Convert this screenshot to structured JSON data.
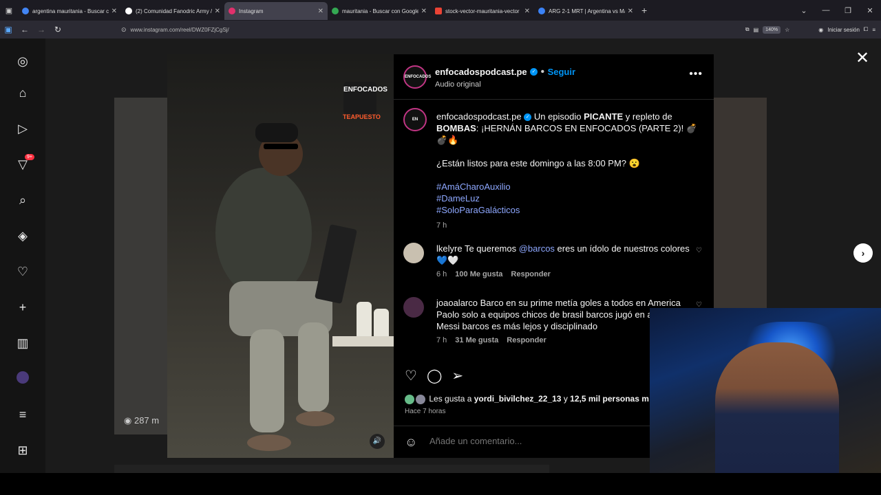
{
  "browser": {
    "tabs": [
      {
        "title": "argentina mauritania - Buscar c",
        "color": "#4285f4"
      },
      {
        "title": "(2) Comunidad Fanodric Army /",
        "color": "#ffffff"
      },
      {
        "title": "Instagram",
        "color": "#e1306c"
      },
      {
        "title": "mauritania - Buscar con Google",
        "color": "#34a853"
      },
      {
        "title": "stock-vector-mauritania-vector",
        "color": "#ea4335"
      },
      {
        "title": "ARG 2-1 MRT | Argentina vs Ma",
        "color": "#3b82f6"
      }
    ],
    "url": "www.instagram.com/reel/DWZ0FZjCgSj/",
    "zoom": "140%",
    "signin": "Iniciar sesión"
  },
  "sidebar": {
    "badge": "9+"
  },
  "background": {
    "views": "287 m"
  },
  "post": {
    "username": "enfocadospodcast.pe",
    "follow": "Seguir",
    "audio": "Audio original",
    "avatar_text": "ENFOCADOS",
    "caption_intro": " Un episodio ",
    "caption_bold1": "PICANTE",
    "caption_mid": " y repleto de ",
    "caption_bold2": "BOMBAS",
    "caption_rest": ": ¡HERNÁN BARCOS EN ENFOCADOS (PARTE 2)! 💣💣🔥",
    "question": "¿Están listos para este domingo a las 8:00 PM? 😮",
    "hashtags": [
      "#AmáCharoAuxilio",
      "#DameLuz",
      "#SoloParaGalácticos"
    ],
    "time": "7 h",
    "comments": [
      {
        "user": "lkelyre",
        "pre": " Te queremos ",
        "mention": "@barcos",
        "post": " eres un ídolo de nuestros colores 💙🤍",
        "time": "6 h",
        "likes": "100 Me gusta",
        "reply": "Responder"
      },
      {
        "user": "joaoalarco",
        "pre": " Barco en su prime metía goles a todos en America Paolo solo a equipos chicos de brasil barcos jugó en a con Messi barcos es más lejos y disciplinado",
        "mention": "",
        "post": "",
        "time": "7 h",
        "likes": "31 Me gusta",
        "reply": "Responder"
      }
    ],
    "likes_pre": "Les gusta a ",
    "likes_user": "yordi_bivilchez_22_13",
    "likes_post": " y ",
    "likes_count": "12,5 mil personas m",
    "ago": "Hace 7 horas",
    "add_comment": "Añade un comentario..."
  },
  "video": {
    "logo": "ENFOCADOS",
    "sponsor": "TEAPUESTO"
  }
}
